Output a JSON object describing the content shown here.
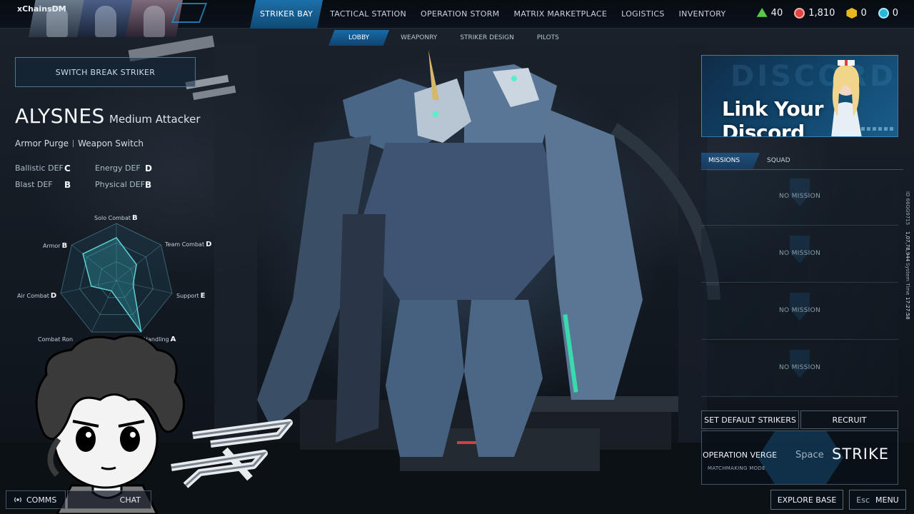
{
  "player": {
    "name": "xChainsDM"
  },
  "nav": {
    "main": [
      "STRIKER BAY",
      "TACTICAL STATION",
      "OPERATION STORM",
      "MATRIX MARKETPLACE",
      "LOGISTICS",
      "INVENTORY"
    ],
    "active_main": "STRIKER BAY",
    "sub": [
      "LOBBY",
      "WEAPONRY",
      "STRIKER DESIGN",
      "PILOTS"
    ],
    "active_sub": "LOBBY"
  },
  "currencies": [
    {
      "icon": "green-triangle-icon",
      "value": "40"
    },
    {
      "icon": "red-medal-icon",
      "value": "1,810"
    },
    {
      "icon": "gold-hex-icon",
      "value": "0"
    },
    {
      "icon": "cyan-coin-icon",
      "value": "0"
    }
  ],
  "striker": {
    "switch_label": "SWITCH BREAK STRIKER",
    "name": "ALYSNES",
    "role": "Medium Attacker",
    "abilities": [
      "Armor Purge",
      "Weapon Switch"
    ],
    "defense": [
      {
        "label": "Ballistic DEF",
        "grade": "C"
      },
      {
        "label": "Energy DEF",
        "grade": "D"
      },
      {
        "label": "Blast DEF",
        "grade": "B"
      },
      {
        "label": "Physical DEF",
        "grade": "B"
      }
    ],
    "radar": [
      {
        "label": "Solo Combat",
        "grade": "B",
        "level": 0.75
      },
      {
        "label": "Team Combat",
        "grade": "D",
        "level": 0.45
      },
      {
        "label": "Support",
        "grade": "E",
        "level": 0.3
      },
      {
        "label": "Handling",
        "grade": "A",
        "level": 1.0
      },
      {
        "label": "Combat Ron",
        "grade": "",
        "level": 0.2
      },
      {
        "label": "Air Combat",
        "grade": "D",
        "level": 0.45
      },
      {
        "label": "Armor",
        "grade": "B",
        "level": 0.75
      }
    ]
  },
  "overlay": {
    "comms_label": "COMMS",
    "chat_label": "CHAT"
  },
  "discord": {
    "title": "Link Your Discord",
    "bg_word": "DISCORD"
  },
  "right_tabs": [
    "MISSIONS",
    "SQUAD"
  ],
  "missions": [
    "NO MISSION",
    "NO MISSION",
    "NO MISSION",
    "NO MISSION"
  ],
  "side_info": {
    "id": "ID 66GG9715",
    "id_value": "1,07,78,944",
    "system_time_label": "System Time",
    "time": "17:27:58"
  },
  "actions": {
    "set_default": "SET DEFAULT STRIKERS",
    "recruit": "RECRUIT",
    "operation": "OPERATION VERGE",
    "mode": "MATCHMAKING MODE",
    "key": "Space",
    "strike": "STRIKE",
    "explore": "EXPLORE BASE",
    "menu_key": "Esc",
    "menu": "MENU"
  },
  "colors": {
    "accent": "#1d6fa8",
    "active_tab": "#0f4a76"
  }
}
